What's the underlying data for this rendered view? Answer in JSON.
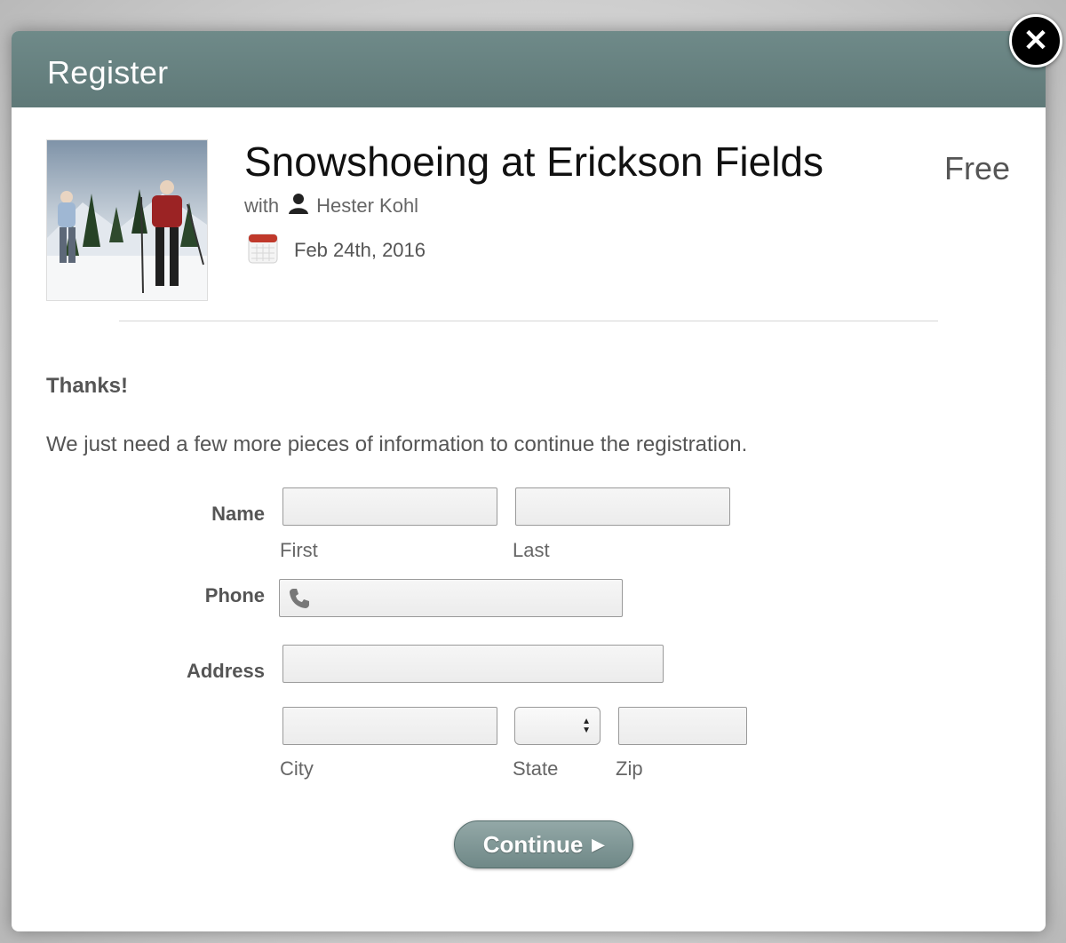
{
  "modal": {
    "title": "Register",
    "close_glyph": "✕"
  },
  "event": {
    "title": "Snowshoeing at Erickson Fields",
    "price": "Free",
    "with_label": "with",
    "host": "Hester Kohl",
    "date": "Feb 24th, 2016"
  },
  "message": {
    "heading": "Thanks!",
    "body": "We just need a few more pieces of information to continue the registration."
  },
  "form": {
    "name_label": "Name",
    "first_label": "First",
    "last_label": "Last",
    "first_value": "",
    "last_value": "",
    "phone_label": "Phone",
    "phone_value": "",
    "address_label": "Address",
    "address_value": "",
    "city_label": "City",
    "city_value": "",
    "state_label": "State",
    "state_value": "",
    "zip_label": "Zip",
    "zip_value": "",
    "continue_label": "Continue",
    "continue_arrow": "▶"
  },
  "icons": {
    "close": "close-icon",
    "person": "person-icon",
    "calendar": "calendar-icon",
    "phone": "phone-icon",
    "select_arrows": "select-arrows-icon"
  },
  "colors": {
    "header": "#647e7d",
    "button": "#7f9695",
    "calendar_accent": "#c0392b"
  }
}
